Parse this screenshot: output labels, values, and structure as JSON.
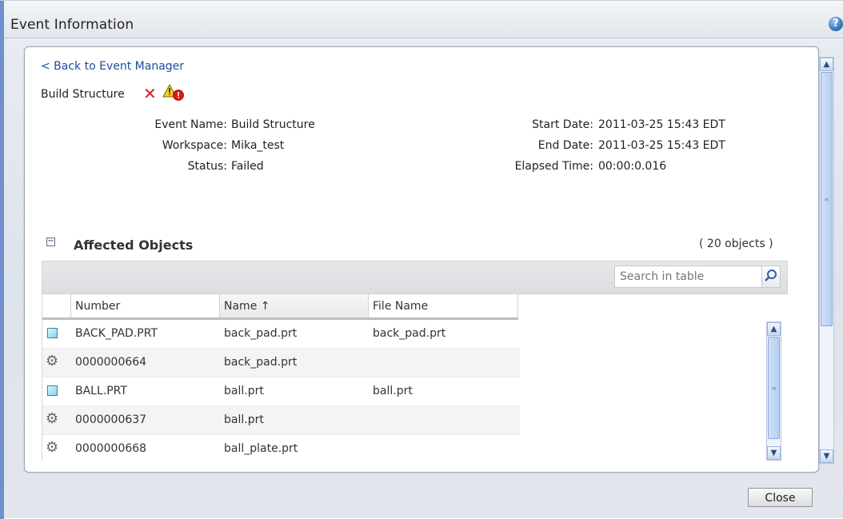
{
  "window": {
    "title": "Event Information",
    "help_icon": "?"
  },
  "nav": {
    "back_label": "< Back to Event Manager"
  },
  "event": {
    "heading": "Build Structure",
    "icons": [
      "failed-x-icon",
      "warning-error-icon"
    ],
    "left_fields": [
      {
        "label": "Event Name:",
        "value": "Build Structure"
      },
      {
        "label": "Workspace:",
        "value": "Mika_test"
      },
      {
        "label": "Status:",
        "value": "Failed"
      }
    ],
    "right_fields": [
      {
        "label": "Start Date:",
        "value": "2011-03-25 15:43 EDT"
      },
      {
        "label": "End Date:",
        "value": "2011-03-25 15:43 EDT"
      },
      {
        "label": "Elapsed Time:",
        "value": "00:00:0.016"
      }
    ]
  },
  "affected": {
    "toggle": "−",
    "title": "Affected Objects",
    "count": "( 20 objects )",
    "search": {
      "placeholder": "Search in table"
    },
    "columns": [
      "Number",
      "Name ↑",
      "File Name"
    ],
    "rows": [
      {
        "icon": "part-cube-icon",
        "number": "BACK_PAD.PRT",
        "name": "back_pad.prt",
        "file": "back_pad.prt"
      },
      {
        "icon": "gear-icon",
        "number": "0000000664",
        "name": "back_pad.prt",
        "file": ""
      },
      {
        "icon": "part-cube-icon",
        "number": "BALL.PRT",
        "name": "ball.prt",
        "file": "ball.prt"
      },
      {
        "icon": "gear-icon",
        "number": "0000000637",
        "name": "ball.prt",
        "file": ""
      },
      {
        "icon": "gear-icon",
        "number": "0000000668",
        "name": "ball_plate.prt",
        "file": ""
      }
    ]
  },
  "footer": {
    "close_label": "Close"
  },
  "colors": {
    "link": "#1d4e9a",
    "error": "#cc1f1f",
    "accent_rail": "#6e8fd0"
  }
}
